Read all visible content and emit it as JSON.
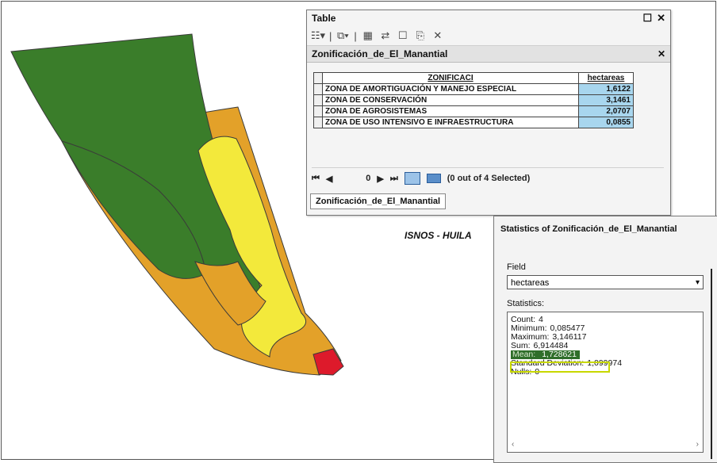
{
  "colors": {
    "green": "#3a7d2a",
    "orange": "#e3a129",
    "yellow": "#f3e93b",
    "red": "#dd1a2b",
    "selection_blue": "#a8d6ee"
  },
  "map_label": "ISNOS - HUILA",
  "table_window": {
    "title": "Table",
    "toolbar_icons": [
      "table-options-icon",
      "related-tables-icon",
      "select-by-attributes-icon",
      "switch-selection-icon",
      "clear-selection-icon",
      "copy-selected-icon",
      "delete-selected-icon"
    ],
    "subtitle": "Zonificación_de_El_Manantial",
    "columns": [
      "ZONIFICACI",
      "hectareas"
    ],
    "rows": [
      {
        "zonificaci": "ZONA DE AMORTIGUACIÓN Y MANEJO ESPECIAL",
        "hectareas": "1,6122"
      },
      {
        "zonificaci": "ZONA DE CONSERVACIÓN",
        "hectareas": "3,1461"
      },
      {
        "zonificaci": "ZONA DE AGROSISTEMAS",
        "hectareas": "2,0707"
      },
      {
        "zonificaci": "ZONA DE USO INTENSIVO E INFRAESTRUCTURA",
        "hectareas": "0,0855"
      }
    ],
    "record_position": "0",
    "selection_status": "(0 out of 4 Selected)",
    "tab_label": "Zonificación_de_El_Manantial"
  },
  "stats_window": {
    "title": "Statistics of Zonificación_de_El_Manantial",
    "field_label": "Field",
    "field_value": "hectareas",
    "statistics_label": "Statistics:",
    "stats": [
      {
        "key": "Count:",
        "value": "4"
      },
      {
        "key": "Minimum:",
        "value": "0,085477"
      },
      {
        "key": "Maximum:",
        "value": "3,146117"
      },
      {
        "key": "Sum:",
        "value": "6,914484"
      },
      {
        "key": "Mean:",
        "value": "1,728621"
      },
      {
        "key": "Standard Deviation:",
        "value": "1,099974"
      },
      {
        "key": "Nulls:",
        "value": "0"
      }
    ]
  }
}
